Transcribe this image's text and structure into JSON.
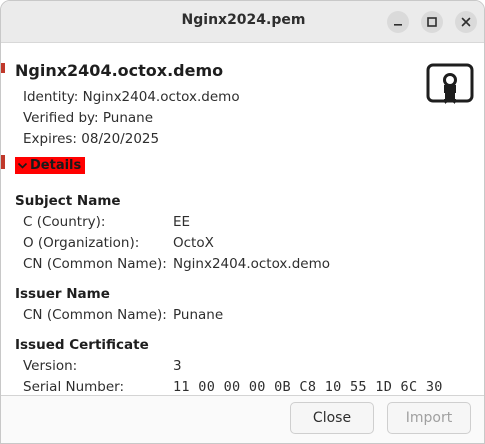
{
  "window": {
    "title": "Nginx2024.pem"
  },
  "certificate": {
    "common_name": "Nginx2404.octox.demo",
    "identity": "Identity: Nginx2404.octox.demo",
    "verified_by": "Verified by: Punane",
    "expires": "Expires: 08/20/2025",
    "icon": "certificate-icon"
  },
  "details": {
    "toggle_label": "Details",
    "subject": {
      "heading": "Subject Name",
      "rows": [
        {
          "label": "C (Country):",
          "value": "EE"
        },
        {
          "label": "O (Organization):",
          "value": "OctoX"
        },
        {
          "label": "CN (Common Name):",
          "value": "Nginx2404.octox.demo"
        }
      ]
    },
    "issuer": {
      "heading": "Issuer Name",
      "rows": [
        {
          "label": "CN (Common Name):",
          "value": "Punane"
        }
      ]
    },
    "issued": {
      "heading": "Issued Certificate",
      "rows": [
        {
          "label": "Version:",
          "value": "3"
        },
        {
          "label": "Serial Number:",
          "value": "11 00 00 00 0B C8 10 55 1D 6C 30"
        }
      ]
    }
  },
  "buttons": {
    "close_label": "Close",
    "import_label": "Import"
  },
  "colors": {
    "details_highlight": "#ff0000"
  }
}
